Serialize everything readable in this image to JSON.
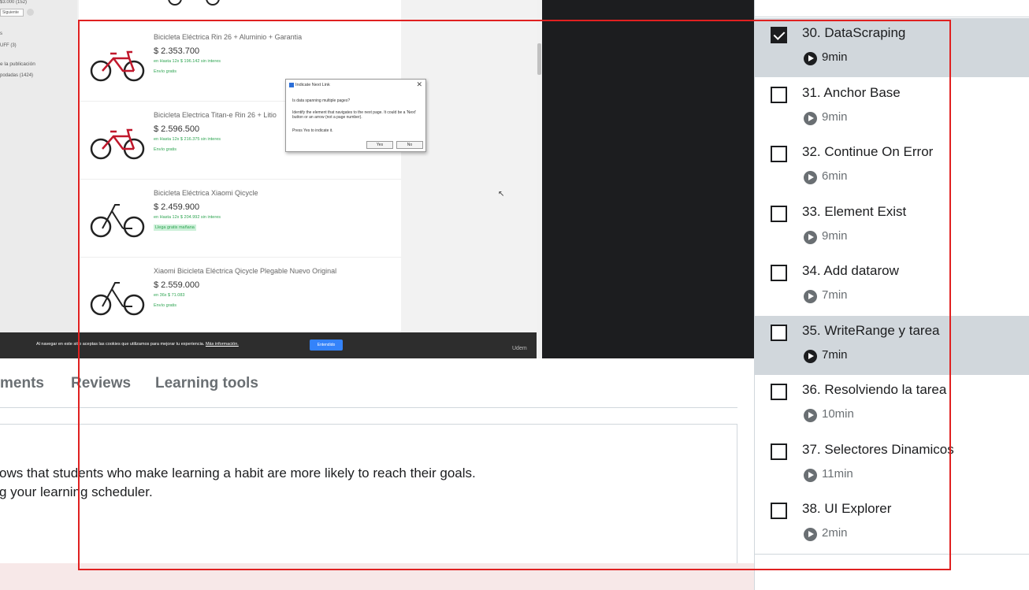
{
  "video": {
    "filters": {
      "price_range": "$3.000 (152)",
      "search_button": "Siguiente",
      "group_label": "s",
      "option": "UFF (3)",
      "section": "e la publicación",
      "option2": "podadas (1424)"
    },
    "listing": [
      {
        "title": "Bicicleta Eléctrica Rin 26 + Aluminio + Garantia",
        "price": "$ 2.353.700",
        "installments": "en Hasta 12x $ 196.142 sin interes",
        "shipping": "Envío gratis",
        "shipping_badge": false
      },
      {
        "title": "Bicicleta Electrica Titan-e Rin 26 + Litio",
        "price": "$ 2.596.500",
        "installments": "en Hasta 12x $ 216.375 sin interes",
        "shipping": "Envío gratis",
        "shipping_badge": false
      },
      {
        "title": "Bicicleta Eléctrica Xiaomi Qicycle",
        "price": "$ 2.459.900",
        "installments": "en Hasta 12x $ 204.992 sin interes",
        "shipping": "Llega gratis mañana",
        "shipping_badge": true
      },
      {
        "title": "Xiaomi Bicicleta Eléctrica Qicycle Plegable Nuevo Original",
        "price": "$ 2.559.000",
        "installments": "en 36x $ 71.083",
        "shipping": "Envío gratis",
        "shipping_badge": false
      }
    ],
    "dialog": {
      "title": "Indicate Next Link",
      "question": "Is data spanning multiple pages?",
      "description": "Identify the element that navigates to the next page. It could be a 'Next' button or an arrow (not a page number).",
      "press": "Press Yes to indicate it.",
      "yes": "Yes",
      "no": "No",
      "close": "✕"
    },
    "cookie": {
      "text": "Al navegar en este sitio aceptas las cookies que utilizamos para mejorar tu experiencia.",
      "link": "Más información.",
      "button": "Entendido"
    },
    "watermark": "Udem"
  },
  "tabs": [
    {
      "label": "ments"
    },
    {
      "label": "Reviews"
    },
    {
      "label": "Learning tools"
    }
  ],
  "message": {
    "line1": "ows that students who make learning a habit are more likely to reach their goals.",
    "line2": "g your learning scheduler."
  },
  "sidebar": {
    "lectures": [
      {
        "title": "30. DataScraping",
        "duration": "9min",
        "checked": true,
        "active": true
      },
      {
        "title": "31. Anchor Base",
        "duration": "9min",
        "checked": false,
        "active": false
      },
      {
        "title": "32. Continue On Error",
        "duration": "6min",
        "checked": false,
        "active": false
      },
      {
        "title": "33. Element Exist",
        "duration": "9min",
        "checked": false,
        "active": false
      },
      {
        "title": "34. Add datarow",
        "duration": "7min",
        "checked": false,
        "active": false
      },
      {
        "title": "35. WriteRange y tarea",
        "duration": "7min",
        "checked": false,
        "active": true
      },
      {
        "title": "36. Resolviendo la tarea",
        "duration": "10min",
        "checked": false,
        "active": false
      },
      {
        "title": "37. Selectores Dinamicos",
        "duration": "11min",
        "checked": false,
        "active": false
      },
      {
        "title": "38. UI Explorer",
        "duration": "2min",
        "checked": false,
        "active": false
      }
    ]
  },
  "colors": {
    "accent_dark": "#1c1d1f",
    "active_row": "#d1d7dc",
    "selection": "#e02020",
    "ml_blue": "#3483fa",
    "ml_green": "#2fa552"
  }
}
